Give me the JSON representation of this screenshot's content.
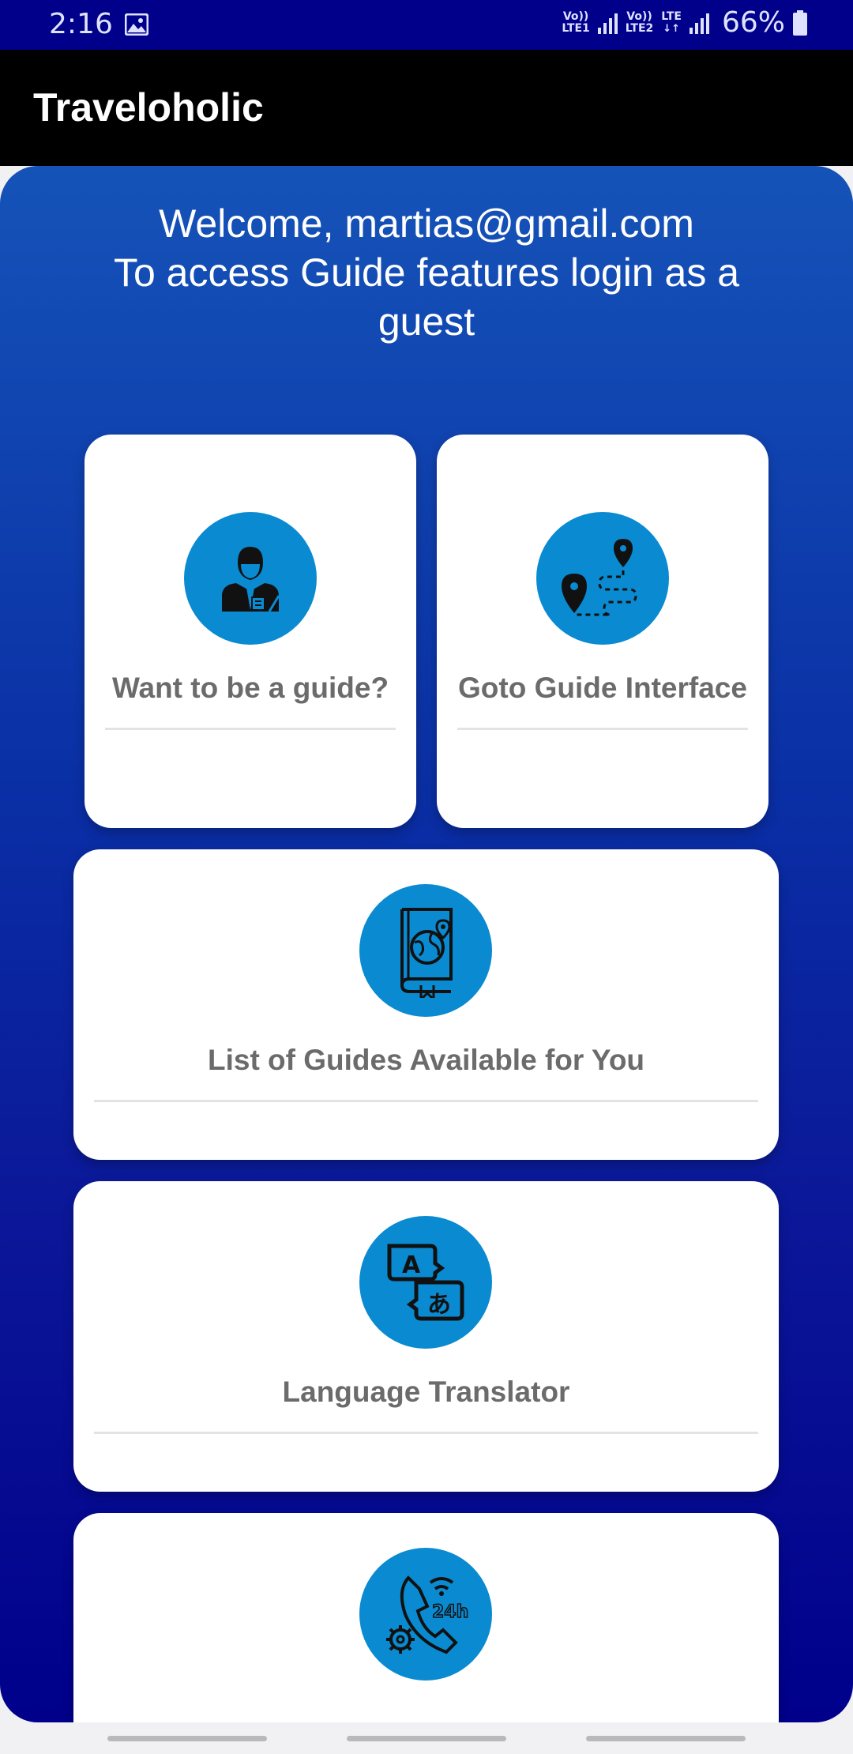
{
  "status_bar": {
    "time": "2:16",
    "network1_top": "Vo))",
    "network1_bottom": "LTE1",
    "network2_top": "Vo))",
    "network2_bottom": "LTE2",
    "network3": "LTE",
    "battery": "66%"
  },
  "app_bar": {
    "title": "Traveloholic"
  },
  "welcome": {
    "line1": "Welcome, martias@gmail.com",
    "line2": "To access Guide features login as a guest"
  },
  "cards": {
    "become_guide": {
      "label": "Want to be a guide?",
      "icon": "guide-person-icon"
    },
    "guide_interface": {
      "label": "Goto Guide Interface",
      "icon": "route-map-icon"
    },
    "guides_list": {
      "label": "List of Guides Available for You",
      "icon": "travel-book-icon"
    },
    "translator": {
      "label": "Language Translator",
      "icon": "translate-icon"
    },
    "support": {
      "label": "",
      "icon": "support-24h-icon"
    }
  },
  "colors": {
    "status_bar": "#00008b",
    "app_bar": "#000000",
    "panel_top": "#1553b8",
    "panel_bottom": "#00008b",
    "icon_circle": "#0a8ad0",
    "card_label": "#6b6b6b"
  }
}
